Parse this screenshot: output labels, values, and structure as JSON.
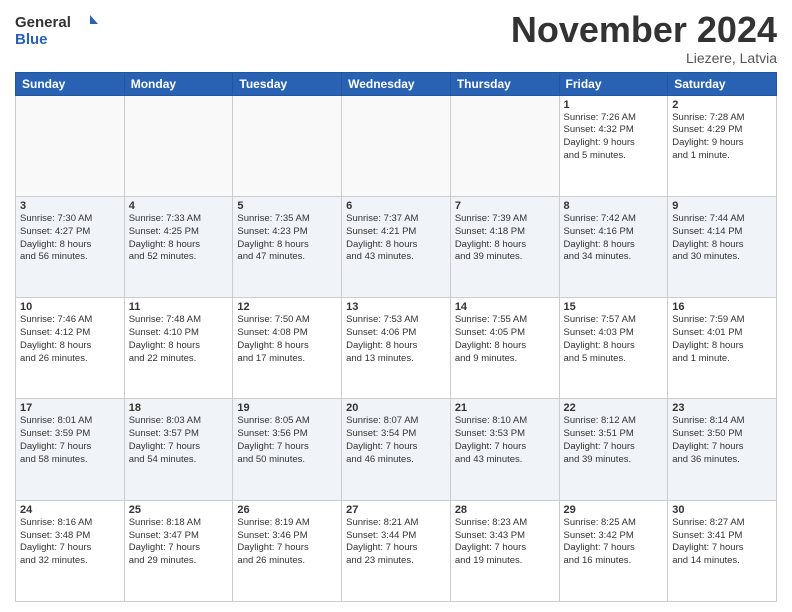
{
  "logo": {
    "line1": "General",
    "line2": "Blue"
  },
  "title": "November 2024",
  "location": "Liezere, Latvia",
  "weekdays": [
    "Sunday",
    "Monday",
    "Tuesday",
    "Wednesday",
    "Thursday",
    "Friday",
    "Saturday"
  ],
  "rows": [
    {
      "shaded": false,
      "cells": [
        {
          "empty": true,
          "day": "",
          "detail": ""
        },
        {
          "empty": true,
          "day": "",
          "detail": ""
        },
        {
          "empty": true,
          "day": "",
          "detail": ""
        },
        {
          "empty": true,
          "day": "",
          "detail": ""
        },
        {
          "empty": true,
          "day": "",
          "detail": ""
        },
        {
          "empty": false,
          "day": "1",
          "detail": "Sunrise: 7:26 AM\nSunset: 4:32 PM\nDaylight: 9 hours\nand 5 minutes."
        },
        {
          "empty": false,
          "day": "2",
          "detail": "Sunrise: 7:28 AM\nSunset: 4:29 PM\nDaylight: 9 hours\nand 1 minute."
        }
      ]
    },
    {
      "shaded": true,
      "cells": [
        {
          "empty": false,
          "day": "3",
          "detail": "Sunrise: 7:30 AM\nSunset: 4:27 PM\nDaylight: 8 hours\nand 56 minutes."
        },
        {
          "empty": false,
          "day": "4",
          "detail": "Sunrise: 7:33 AM\nSunset: 4:25 PM\nDaylight: 8 hours\nand 52 minutes."
        },
        {
          "empty": false,
          "day": "5",
          "detail": "Sunrise: 7:35 AM\nSunset: 4:23 PM\nDaylight: 8 hours\nand 47 minutes."
        },
        {
          "empty": false,
          "day": "6",
          "detail": "Sunrise: 7:37 AM\nSunset: 4:21 PM\nDaylight: 8 hours\nand 43 minutes."
        },
        {
          "empty": false,
          "day": "7",
          "detail": "Sunrise: 7:39 AM\nSunset: 4:18 PM\nDaylight: 8 hours\nand 39 minutes."
        },
        {
          "empty": false,
          "day": "8",
          "detail": "Sunrise: 7:42 AM\nSunset: 4:16 PM\nDaylight: 8 hours\nand 34 minutes."
        },
        {
          "empty": false,
          "day": "9",
          "detail": "Sunrise: 7:44 AM\nSunset: 4:14 PM\nDaylight: 8 hours\nand 30 minutes."
        }
      ]
    },
    {
      "shaded": false,
      "cells": [
        {
          "empty": false,
          "day": "10",
          "detail": "Sunrise: 7:46 AM\nSunset: 4:12 PM\nDaylight: 8 hours\nand 26 minutes."
        },
        {
          "empty": false,
          "day": "11",
          "detail": "Sunrise: 7:48 AM\nSunset: 4:10 PM\nDaylight: 8 hours\nand 22 minutes."
        },
        {
          "empty": false,
          "day": "12",
          "detail": "Sunrise: 7:50 AM\nSunset: 4:08 PM\nDaylight: 8 hours\nand 17 minutes."
        },
        {
          "empty": false,
          "day": "13",
          "detail": "Sunrise: 7:53 AM\nSunset: 4:06 PM\nDaylight: 8 hours\nand 13 minutes."
        },
        {
          "empty": false,
          "day": "14",
          "detail": "Sunrise: 7:55 AM\nSunset: 4:05 PM\nDaylight: 8 hours\nand 9 minutes."
        },
        {
          "empty": false,
          "day": "15",
          "detail": "Sunrise: 7:57 AM\nSunset: 4:03 PM\nDaylight: 8 hours\nand 5 minutes."
        },
        {
          "empty": false,
          "day": "16",
          "detail": "Sunrise: 7:59 AM\nSunset: 4:01 PM\nDaylight: 8 hours\nand 1 minute."
        }
      ]
    },
    {
      "shaded": true,
      "cells": [
        {
          "empty": false,
          "day": "17",
          "detail": "Sunrise: 8:01 AM\nSunset: 3:59 PM\nDaylight: 7 hours\nand 58 minutes."
        },
        {
          "empty": false,
          "day": "18",
          "detail": "Sunrise: 8:03 AM\nSunset: 3:57 PM\nDaylight: 7 hours\nand 54 minutes."
        },
        {
          "empty": false,
          "day": "19",
          "detail": "Sunrise: 8:05 AM\nSunset: 3:56 PM\nDaylight: 7 hours\nand 50 minutes."
        },
        {
          "empty": false,
          "day": "20",
          "detail": "Sunrise: 8:07 AM\nSunset: 3:54 PM\nDaylight: 7 hours\nand 46 minutes."
        },
        {
          "empty": false,
          "day": "21",
          "detail": "Sunrise: 8:10 AM\nSunset: 3:53 PM\nDaylight: 7 hours\nand 43 minutes."
        },
        {
          "empty": false,
          "day": "22",
          "detail": "Sunrise: 8:12 AM\nSunset: 3:51 PM\nDaylight: 7 hours\nand 39 minutes."
        },
        {
          "empty": false,
          "day": "23",
          "detail": "Sunrise: 8:14 AM\nSunset: 3:50 PM\nDaylight: 7 hours\nand 36 minutes."
        }
      ]
    },
    {
      "shaded": false,
      "cells": [
        {
          "empty": false,
          "day": "24",
          "detail": "Sunrise: 8:16 AM\nSunset: 3:48 PM\nDaylight: 7 hours\nand 32 minutes."
        },
        {
          "empty": false,
          "day": "25",
          "detail": "Sunrise: 8:18 AM\nSunset: 3:47 PM\nDaylight: 7 hours\nand 29 minutes."
        },
        {
          "empty": false,
          "day": "26",
          "detail": "Sunrise: 8:19 AM\nSunset: 3:46 PM\nDaylight: 7 hours\nand 26 minutes."
        },
        {
          "empty": false,
          "day": "27",
          "detail": "Sunrise: 8:21 AM\nSunset: 3:44 PM\nDaylight: 7 hours\nand 23 minutes."
        },
        {
          "empty": false,
          "day": "28",
          "detail": "Sunrise: 8:23 AM\nSunset: 3:43 PM\nDaylight: 7 hours\nand 19 minutes."
        },
        {
          "empty": false,
          "day": "29",
          "detail": "Sunrise: 8:25 AM\nSunset: 3:42 PM\nDaylight: 7 hours\nand 16 minutes."
        },
        {
          "empty": false,
          "day": "30",
          "detail": "Sunrise: 8:27 AM\nSunset: 3:41 PM\nDaylight: 7 hours\nand 14 minutes."
        }
      ]
    }
  ]
}
